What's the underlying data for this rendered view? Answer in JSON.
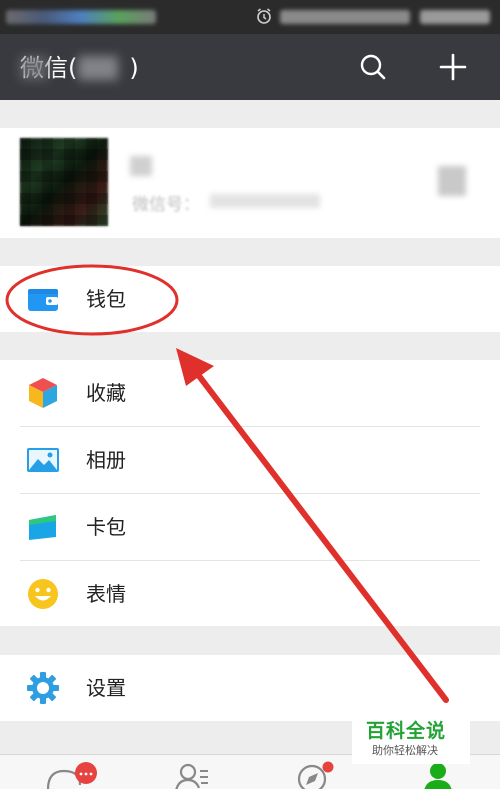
{
  "header": {
    "title": "微信(",
    "title_suffix": ")"
  },
  "profile": {
    "wechat_id_label": "微信号："
  },
  "menu": {
    "wallet": "钱包",
    "favorites": "收藏",
    "album": "相册",
    "cards": "卡包",
    "stickers": "表情",
    "settings": "设置"
  },
  "watermark": {
    "title": "百科全说",
    "subtitle": "助你轻松解决"
  },
  "colors": {
    "titlebar": "#393a3f",
    "annotation": "#e0302b",
    "tab_active": "#1aad19",
    "badge": "#e64340"
  },
  "icons": {
    "search": "search-icon",
    "add": "plus-icon",
    "wallet": "wallet-icon",
    "favorites": "cube-icon",
    "album": "picture-icon",
    "cards": "card-icon",
    "stickers": "smiley-icon",
    "settings": "gear-icon"
  }
}
